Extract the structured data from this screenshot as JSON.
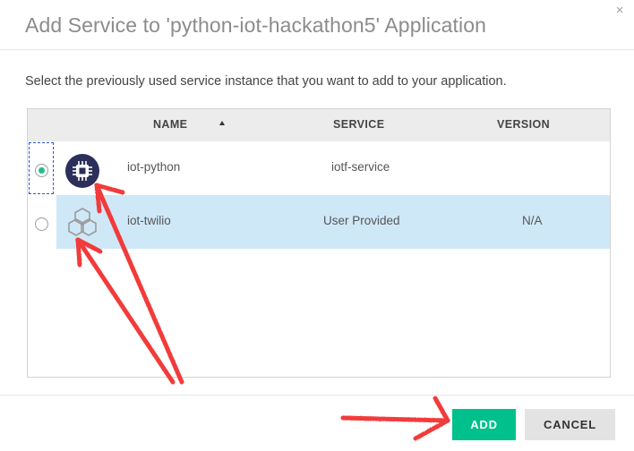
{
  "dialog": {
    "title": "Add Service to 'python-iot-hackathon5' Application",
    "close_glyph": "×",
    "intro": "Select the previously used service instance that you want to add to your application."
  },
  "table": {
    "columns": {
      "name": "NAME",
      "service": "SERVICE",
      "version": "VERSION"
    },
    "sort": {
      "column": "name",
      "direction": "ascending"
    },
    "rows": [
      {
        "name": "iot-python",
        "service": "iotf-service",
        "version": "",
        "icon": "iot-chip-icon",
        "selected": true
      },
      {
        "name": "iot-twilio",
        "service": "User Provided",
        "version": "N/A",
        "icon": "user-provided-hexagon-icon",
        "selected": false
      }
    ]
  },
  "buttons": {
    "add": "ADD",
    "cancel": "CANCEL"
  },
  "colors": {
    "accent": "#00c08b",
    "row_highlight": "#cfe8f8",
    "annotation_arrow": "#f23a3a",
    "icon_dark": "#2b2f5a"
  }
}
